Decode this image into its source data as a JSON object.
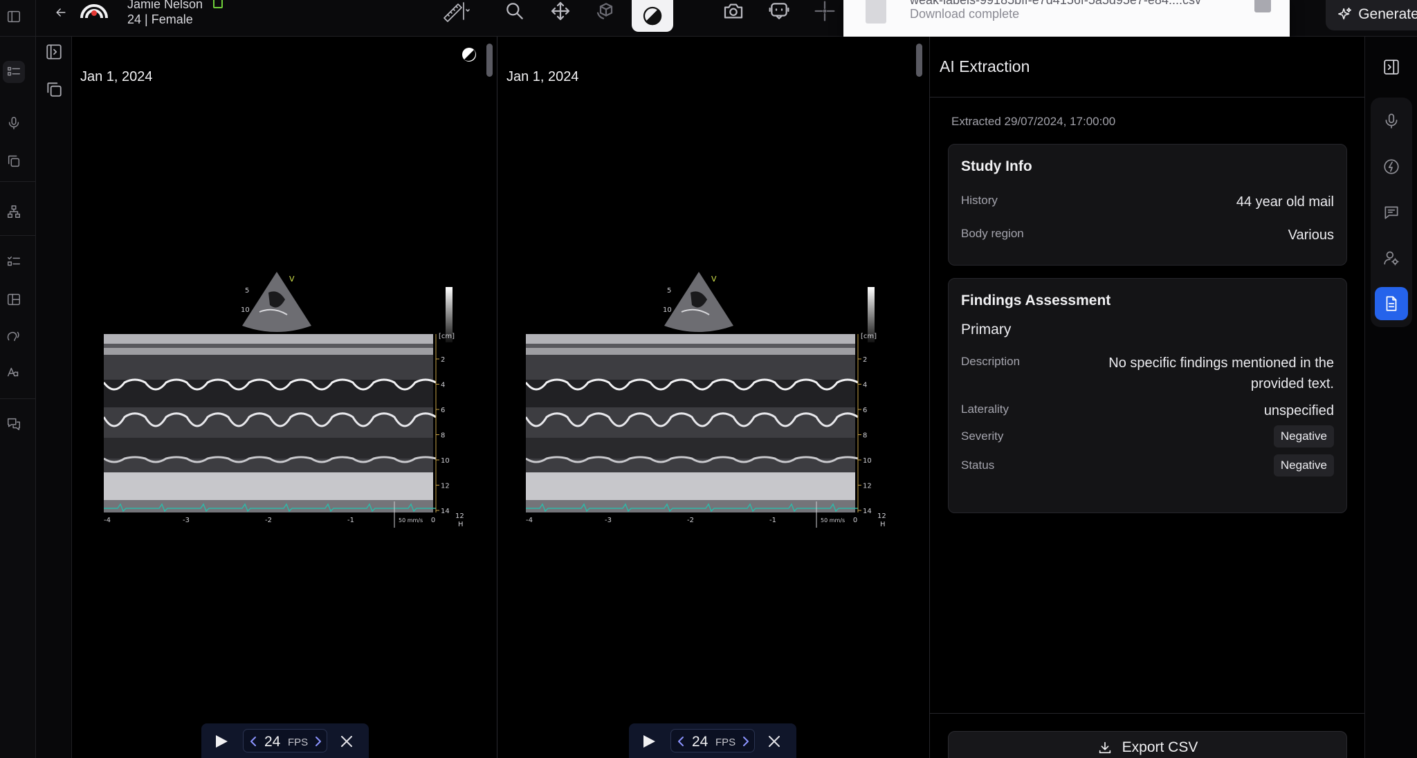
{
  "patient": {
    "name": "Jamie Nelson",
    "details": "24 | Female"
  },
  "notification": {
    "file_name": "weak-labels-99185bff-e7d4156f-5a5d95e7-e84....csv",
    "status": "Download complete"
  },
  "toolbar": {
    "generate_label": "Generate",
    "tools": [
      "ruler-icon",
      "zoom-icon",
      "pan-icon",
      "rotate-3d-icon",
      "contrast-icon",
      "camera-icon",
      "ai-assist-icon",
      "crosshair-icon",
      "reset-icon"
    ],
    "active_tool": "contrast-icon"
  },
  "viewports": [
    {
      "date": "Jan 1, 2024",
      "fps": "24",
      "fps_label": "FPS"
    },
    {
      "date": "Jan 1, 2024",
      "fps": "24",
      "fps_label": "FPS"
    }
  ],
  "echo_image": {
    "depth_unit": "[cm]",
    "depth_ticks": [
      "2",
      "4",
      "6",
      "8",
      "10",
      "12",
      "14"
    ],
    "time_ticks": [
      "-4",
      "-3",
      "-2",
      "-1",
      "0"
    ],
    "sweep_speed": "50 mm/s",
    "heart_rate": "125",
    "hr_label": "HR",
    "sector_depth_labels": [
      "5",
      "10"
    ],
    "marker": "V"
  },
  "ai_panel": {
    "title": "AI Extraction",
    "extracted": "Extracted 29/07/2024, 17:00:00",
    "study_info": {
      "title": "Study Info",
      "history_label": "History",
      "history_value": "44 year old mail",
      "body_region_label": "Body region",
      "body_region_value": "Various"
    },
    "findings": {
      "title": "Findings Assessment",
      "subtitle": "Primary",
      "description_label": "Description",
      "description_line1": "No specific findings mentioned in the",
      "description_line2": "provided text.",
      "laterality_label": "Laterality",
      "laterality_value": "unspecified",
      "severity_label": "Severity",
      "severity_value": "Negative",
      "status_label": "Status",
      "status_value": "Negative"
    },
    "export_label": "Export CSV"
  },
  "colors": {
    "accent": "#2563eb",
    "notification_bg": "#fbfbfc",
    "fps_bar_bg": "#10162a",
    "check_green": "#6fcf3a"
  }
}
